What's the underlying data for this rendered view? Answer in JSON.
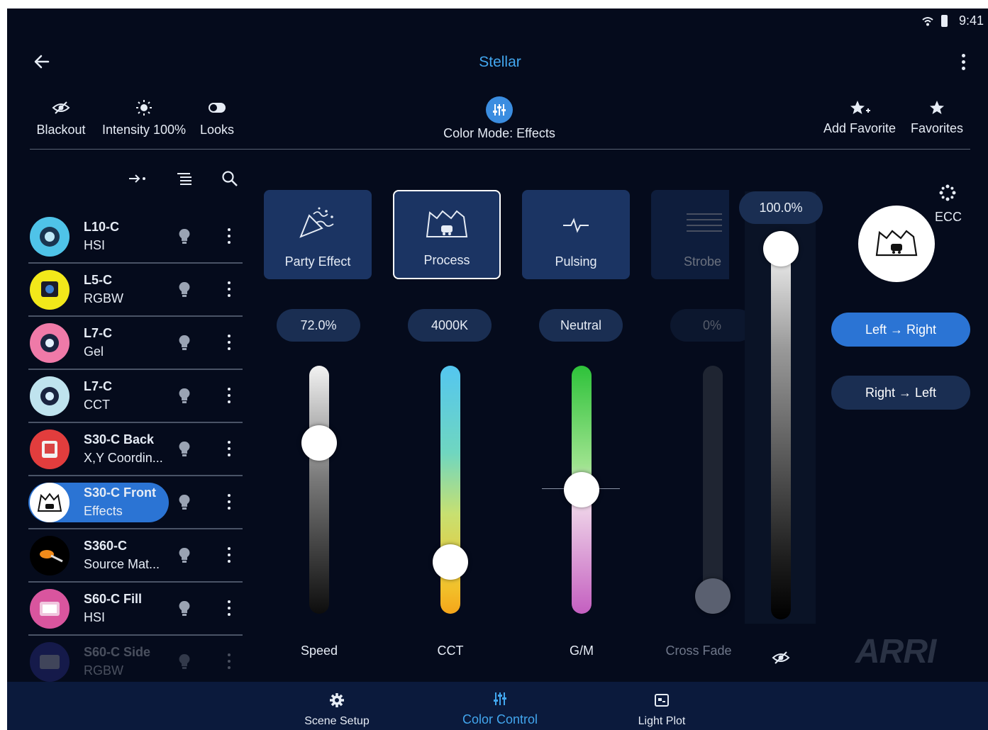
{
  "status": {
    "time": "9:41"
  },
  "header": {
    "title": "Stellar"
  },
  "toolbar": {
    "blackout": "Blackout",
    "intensity": "Intensity 100%",
    "looks": "Looks",
    "color_mode": "Color Mode: Effects",
    "add_favorite": "Add Favorite",
    "favorites": "Favorites"
  },
  "fixtures": [
    {
      "name": "L10-C",
      "mode": "HSI",
      "ring": "#4fc3e8"
    },
    {
      "name": "L5-C",
      "mode": "RGBW",
      "ring": "#f2e81a"
    },
    {
      "name": "L7-C",
      "mode": "Gel",
      "ring": "#ef7aa8"
    },
    {
      "name": "L7-C",
      "mode": "CCT",
      "ring": "#bfe3ee"
    },
    {
      "name": "S30-C Back",
      "mode": "X,Y Coordin...",
      "ring": "#e23d3d"
    },
    {
      "name": "S30-C Front",
      "mode": "Effects",
      "ring": "#ffffff",
      "selected": true
    },
    {
      "name": "S360-C",
      "mode": "Source Mat...",
      "ring": "#000000"
    },
    {
      "name": "S60-C Fill",
      "mode": "HSI",
      "ring": "#d9559e"
    },
    {
      "name": "S60-C Side",
      "mode": "RGBW",
      "ring": "#3a3fb4"
    }
  ],
  "effects": {
    "party": "Party Effect",
    "process": "Process",
    "pulsing": "Pulsing",
    "strobe": "Strobe",
    "selected": "Process"
  },
  "sliders": {
    "speed": {
      "label": "Speed",
      "value": "72.0%",
      "level": 0.72
    },
    "cct": {
      "label": "CCT",
      "value": "4000K",
      "level": 0.16
    },
    "gm": {
      "label": "G/M",
      "value": "Neutral",
      "level": 0.5
    },
    "crossfade": {
      "label": "Cross Fade",
      "value": "0%",
      "level": 0.0
    },
    "intensity": {
      "value": "100.0%",
      "level": 1.0
    }
  },
  "right_panel": {
    "ecc": "ECC",
    "left_right": "Left → Right",
    "right_left": "Right → Left",
    "logo": "ARRI"
  },
  "bottom_nav": {
    "scene_setup": "Scene Setup",
    "color_control": "Color Control",
    "light_plot": "Light Plot",
    "active": "Color Control"
  },
  "colors": {
    "accent": "#3b8de0",
    "background": "#050b1c",
    "tile": "#1b3463"
  }
}
